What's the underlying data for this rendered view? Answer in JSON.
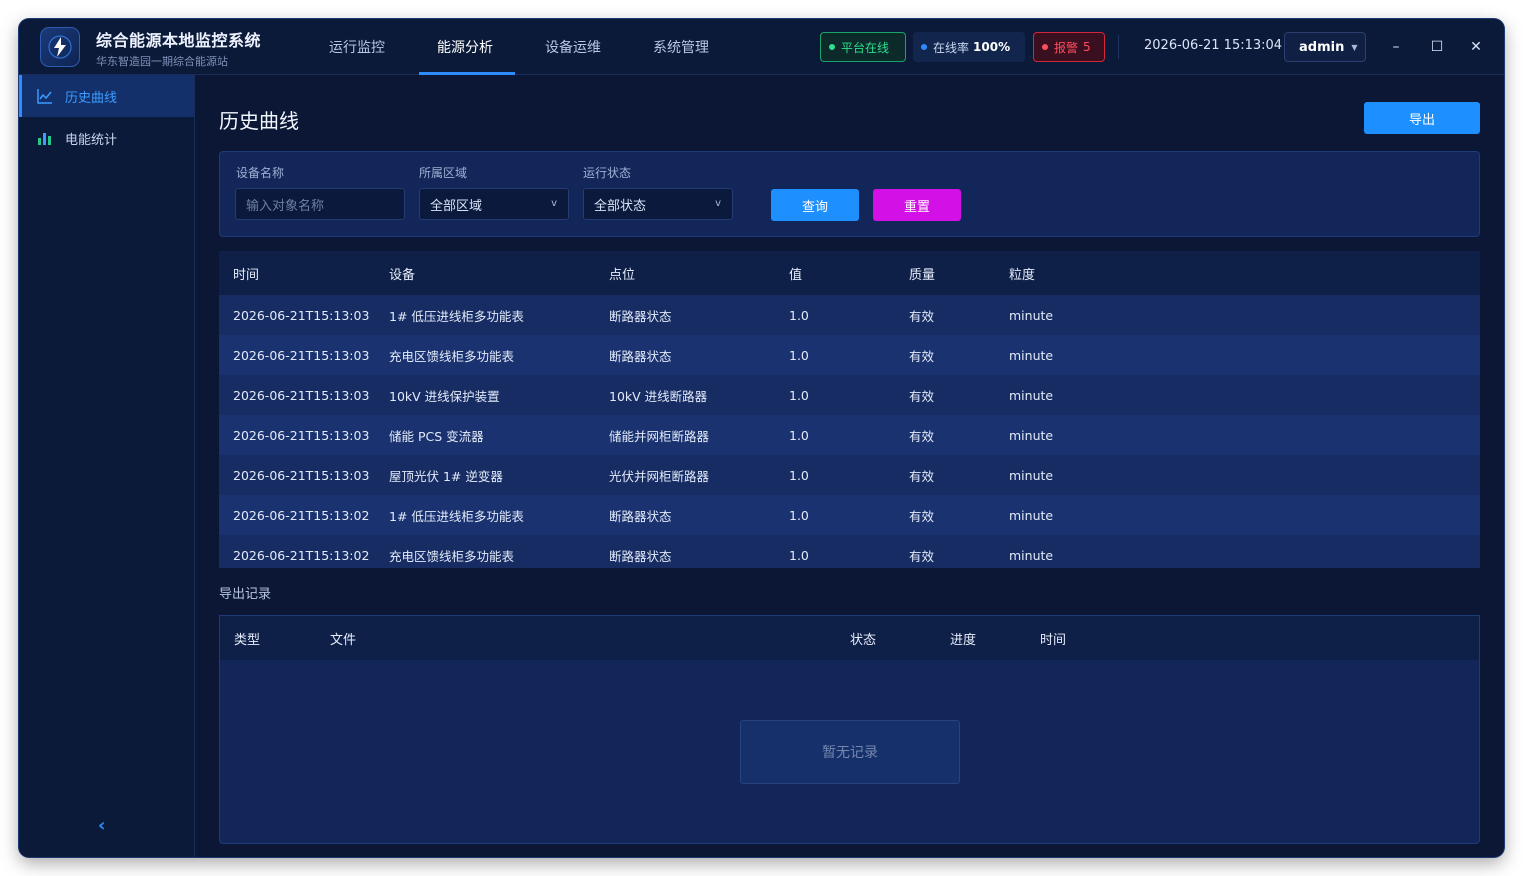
{
  "app": {
    "title": "综合能源本地监控系统",
    "subtitle": "华东智造园一期综合能源站"
  },
  "nav": [
    {
      "label": "运行监控",
      "active": false
    },
    {
      "label": "能源分析",
      "active": true
    },
    {
      "label": "设备运维",
      "active": false
    },
    {
      "label": "系统管理",
      "active": false
    }
  ],
  "status": {
    "platform": "平台在线",
    "online_rate_label": "在线率",
    "online_rate_value": "100%",
    "alarm_label": "报警",
    "alarm_count": "5"
  },
  "datetime": "2026-06-21 15:13:04",
  "user": {
    "name": "admin"
  },
  "window_controls": {
    "minimize": "–",
    "maximize": "☐",
    "close": "✕"
  },
  "sidebar": {
    "items": [
      {
        "label": "历史曲线",
        "icon": "line-chart-icon",
        "active": true
      },
      {
        "label": "电能统计",
        "icon": "bar-chart-icon",
        "active": false
      }
    ],
    "collapse": "‹"
  },
  "page": {
    "title": "历史曲线",
    "export_label": "导出"
  },
  "filter": {
    "device_label": "设备名称",
    "device_placeholder": "输入对象名称",
    "area_label": "所属区域",
    "area_value": "全部区域",
    "state_label": "运行状态",
    "state_value": "全部状态",
    "dropdown_arrow": "v",
    "query_label": "查询",
    "reset_label": "重置"
  },
  "table": {
    "columns": [
      "时间",
      "设备",
      "点位",
      "值",
      "质量",
      "粒度"
    ],
    "rows": [
      [
        "2026-06-21T15:13:03",
        "1# 低压进线柜多功能表",
        "断路器状态",
        "1.0",
        "有效",
        "minute"
      ],
      [
        "2026-06-21T15:13:03",
        "充电区馈线柜多功能表",
        "断路器状态",
        "1.0",
        "有效",
        "minute"
      ],
      [
        "2026-06-21T15:13:03",
        "10kV 进线保护装置",
        "10kV 进线断路器",
        "1.0",
        "有效",
        "minute"
      ],
      [
        "2026-06-21T15:13:03",
        "储能 PCS 变流器",
        "储能并网柜断路器",
        "1.0",
        "有效",
        "minute"
      ],
      [
        "2026-06-21T15:13:03",
        "屋顶光伏 1# 逆变器",
        "光伏并网柜断路器",
        "1.0",
        "有效",
        "minute"
      ],
      [
        "2026-06-21T15:13:02",
        "1# 低压进线柜多功能表",
        "断路器状态",
        "1.0",
        "有效",
        "minute"
      ],
      [
        "2026-06-21T15:13:02",
        "充电区馈线柜多功能表",
        "断路器状态",
        "1.0",
        "有效",
        "minute"
      ]
    ]
  },
  "export_records": {
    "section_label": "导出记录",
    "columns": [
      "类型",
      "文件",
      "状态",
      "进度",
      "时间"
    ],
    "empty_text": "暂无记录"
  },
  "colors": {
    "accent": "#1d8fff",
    "reset": "#d310e6",
    "online": "#2ddf8f",
    "alarm": "#ff4d5e",
    "bg": "#0b1734"
  }
}
